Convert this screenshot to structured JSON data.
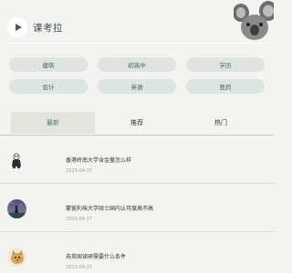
{
  "header": {
    "brand": "课考拉",
    "logo_icon": "play-icon",
    "mascot_icon": "koala-mascot-icon"
  },
  "categories": [
    {
      "label": "建筑"
    },
    {
      "label": "初高中"
    },
    {
      "label": "学历"
    },
    {
      "label": "会计"
    },
    {
      "label": "英语"
    },
    {
      "label": "医药"
    }
  ],
  "tabs": [
    {
      "label": "最新",
      "active": true
    },
    {
      "label": "推荐",
      "active": false
    },
    {
      "label": "热门",
      "active": false
    }
  ],
  "articles": [
    {
      "title": "香港岭南大学含金量怎么样",
      "date": "2023-04-27",
      "thumb": "panda-figure-thumbnail"
    },
    {
      "title": "蒙彼利埃大学硕士国内认可度高不高",
      "date": "2023-04-27",
      "thumb": "night-sky-person-thumbnail"
    },
    {
      "title": "去英国读研需要什么条件",
      "date": "2023-04-27",
      "thumb": "cat-photo-thumbnail"
    }
  ],
  "colors": {
    "background": "#f3f3ef",
    "chip": "#dde4e1",
    "active_tab_text": "#3d7a7b",
    "active_tab_bg": "#e4e4dc"
  }
}
